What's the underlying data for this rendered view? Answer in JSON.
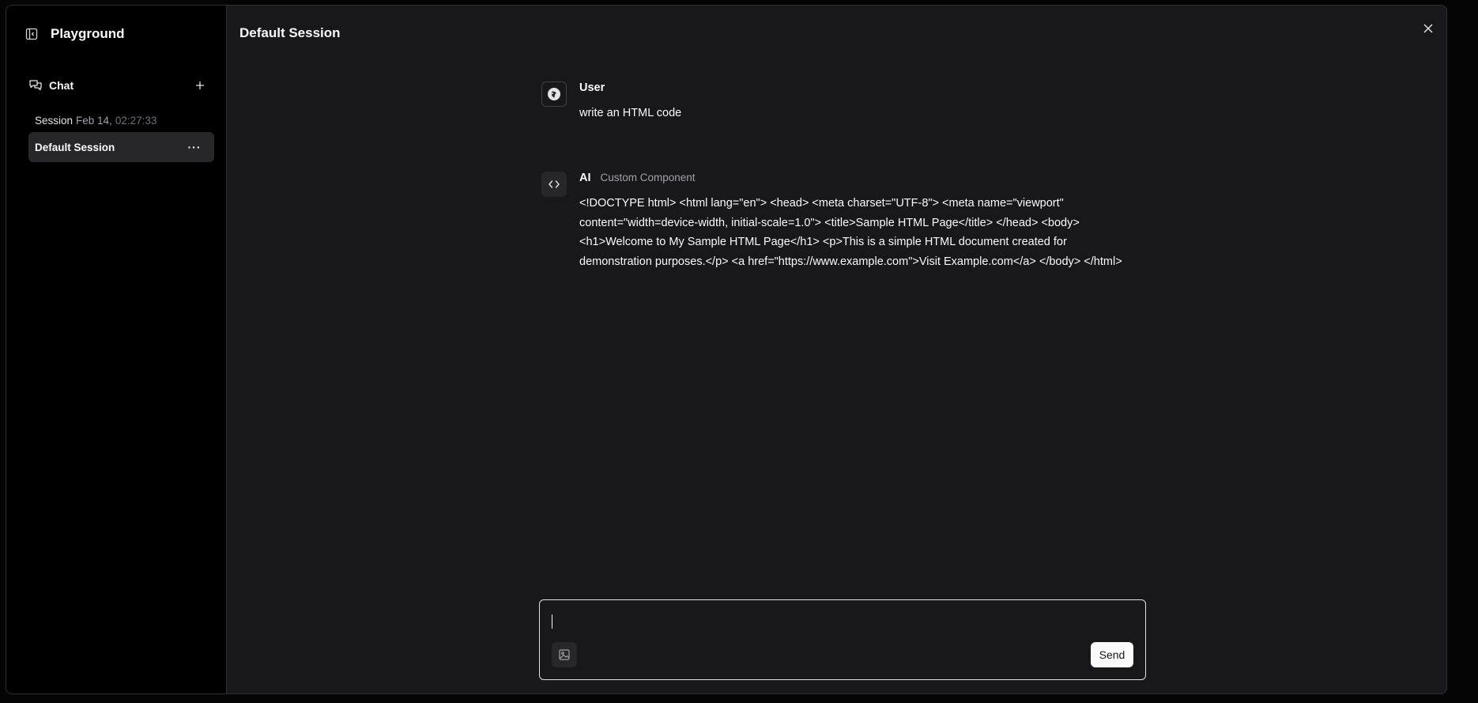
{
  "sidebar": {
    "title": "Playground",
    "toggle_icon": "panel-left-close-icon",
    "chat_label": "Chat",
    "chat_icon": "messages-icon",
    "add_icon": "plus-icon",
    "sessions": [
      {
        "name": "Session",
        "date": "Feb 14,",
        "time": "02:27:33",
        "active": false
      },
      {
        "name": "Default Session",
        "active": true,
        "more_icon": "ellipsis-icon",
        "more_label": "···"
      }
    ]
  },
  "main": {
    "title": "Default Session",
    "close_icon": "close-icon",
    "messages": [
      {
        "sender": "User",
        "avatar_icon": "user-avatar-icon",
        "text": "write an HTML code"
      },
      {
        "sender": "AI",
        "component": "Custom Component",
        "avatar_icon": "code-icon",
        "text": "<!DOCTYPE html> <html lang=\"en\"> <head> <meta charset=\"UTF-8\"> <meta name=\"viewport\" content=\"width=device-width, initial-scale=1.0\"> <title>Sample HTML Page</title> </head> <body> <h1>Welcome to My Sample HTML Page</h1> <p>This is a simple HTML document created for demonstration purposes.</p> <a href=\"https://www.example.com\">Visit Example.com</a> </body> </html>"
      }
    ]
  },
  "composer": {
    "value": "",
    "image_icon": "image-icon",
    "send_label": "Send"
  },
  "colors": {
    "background": "#18181b",
    "sidebar": "#000000",
    "active_session": "#27272a",
    "send_button": "#fafafa"
  }
}
